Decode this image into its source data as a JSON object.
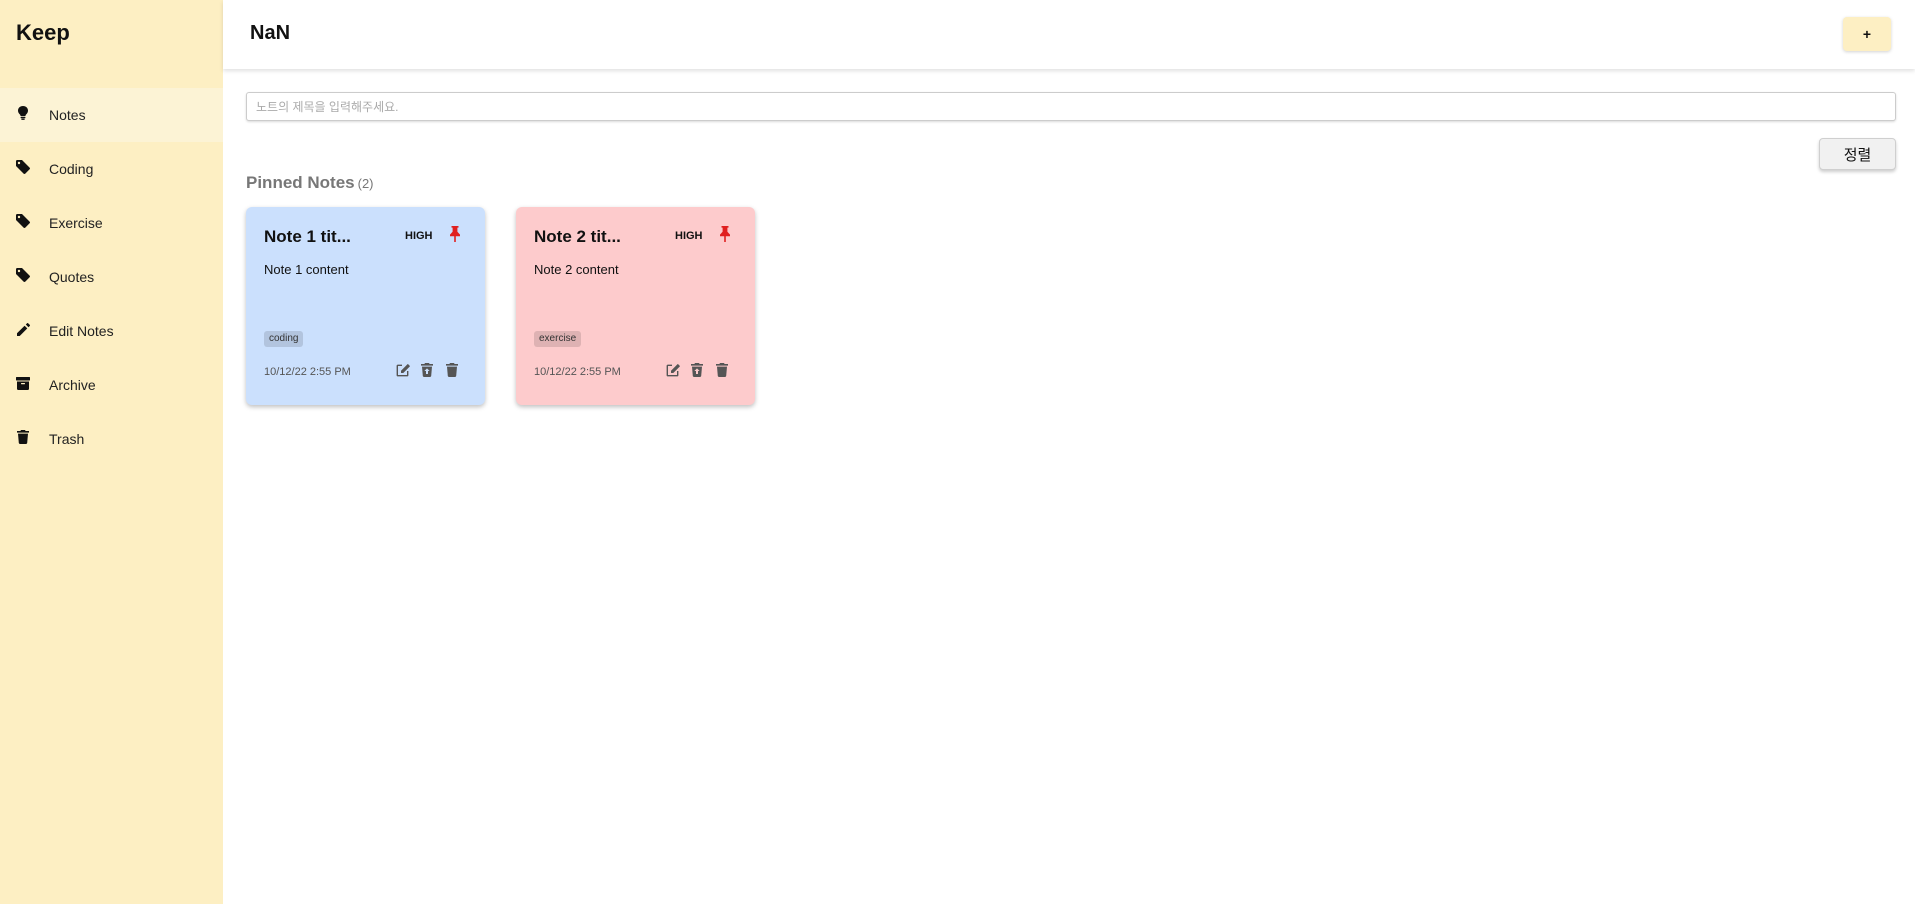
{
  "app": {
    "brand": "Keep"
  },
  "sidebar": {
    "items": [
      {
        "label": "Notes",
        "icon": "lightbulb-icon"
      },
      {
        "label": "Coding",
        "icon": "tag-icon"
      },
      {
        "label": "Exercise",
        "icon": "tag-icon"
      },
      {
        "label": "Quotes",
        "icon": "tag-icon"
      },
      {
        "label": "Edit Notes",
        "icon": "pencil-icon"
      },
      {
        "label": "Archive",
        "icon": "archive-icon"
      },
      {
        "label": "Trash",
        "icon": "trash-icon"
      }
    ],
    "active": "Notes"
  },
  "header": {
    "title": "NaN",
    "add_label": "+"
  },
  "search": {
    "placeholder": "노트의 제목을 입력해주세요.",
    "value": ""
  },
  "sort": {
    "label": "정렬"
  },
  "pinned": {
    "title": "Pinned Notes",
    "count": "(2)",
    "notes": [
      {
        "title": "Note 1 tit...",
        "priority": "HIGH",
        "content": "Note 1 content",
        "tag": "coding",
        "date": "10/12/22 2:55 PM",
        "color": "#cbe0fd"
      },
      {
        "title": "Note 2 tit...",
        "priority": "HIGH",
        "content": "Note 2 content",
        "tag": "exercise",
        "date": "10/12/22 2:55 PM",
        "color": "#fdcbcc"
      }
    ]
  },
  "colors": {
    "sidebar": "#fdefc3",
    "pin": "#e02020",
    "accent": "#fdefc3"
  }
}
